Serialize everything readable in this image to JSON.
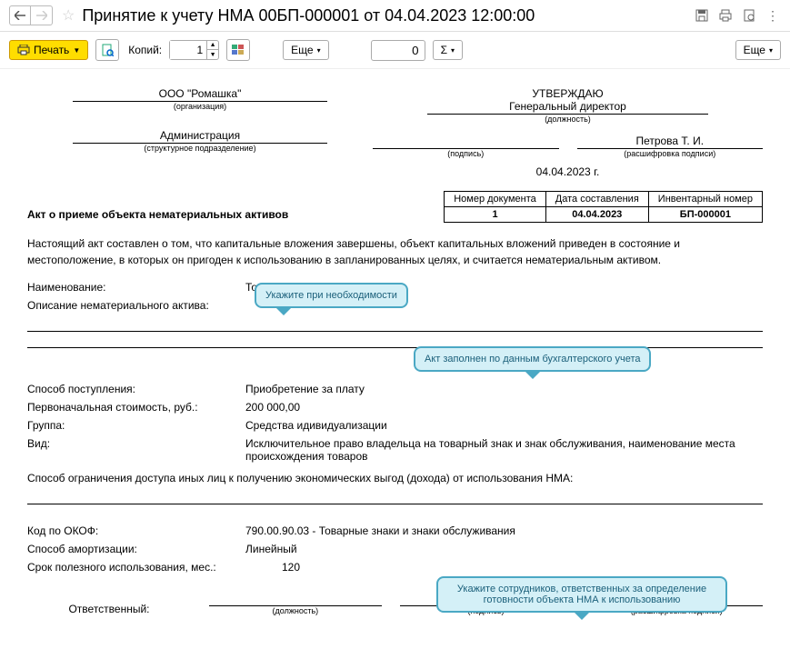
{
  "titlebar": {
    "title": "Принятие к учету НМА 00БП-000001 от 04.04.2023 12:00:00"
  },
  "toolbar": {
    "print": "Печать",
    "copies_label": "Копий:",
    "copies_value": "1",
    "more1": "Еще",
    "num_value": "0",
    "sigma": "Σ",
    "more2": "Еще"
  },
  "header": {
    "org": "ООО \"Ромашка\"",
    "org_cap": "(организация)",
    "dept": "Администрация",
    "dept_cap": "(структурное подразделение)",
    "approve": "УТВЕРЖДАЮ",
    "position": "Генеральный директор",
    "position_cap": "(должность)",
    "sign_cap": "(подпись)",
    "name": "Петрова Т. И.",
    "name_cap": "(расшифровка подписи)",
    "date": "04.04.2023 г."
  },
  "act": {
    "title": "Акт о приеме объекта нематериальных активов",
    "col1": "Номер документа",
    "col2": "Дата составления",
    "col3": "Инвентарный номер",
    "val1": "1",
    "val2": "04.04.2023",
    "val3": "БП-000001"
  },
  "body": {
    "text": "Настоящий акт составлен о том, что капитальные вложения завершены, объект капитальных вложений приведен в состояние и местоположение, в которых он пригоден к использованию в запланированных целях, и считается нематериальным активом.",
    "name_label": "Наименование:",
    "name_value": "Товарный знак",
    "desc_label": "Описание нематериального актива:",
    "method_label": "Способ поступления:",
    "method_value": "Приобретение за плату",
    "cost_label": "Первоначальная стоимость, руб.:",
    "cost_value": "200 000,00",
    "group_label": "Группа:",
    "group_value": "Средства идивидуализации",
    "kind_label": "Вид:",
    "kind_value": "Исключительное право владельца на товарный знак и знак обслуживания, наименование места происхождения товаров",
    "restrict": "Способ ограничения доступа иных лиц к получению экономических выгод (дохода) от использования НМА:",
    "okof_label": "Код по ОКОФ:",
    "okof_value": "790.00.90.03 - Товарные знаки и знаки обслуживания",
    "amort_label": "Способ амортизации:",
    "amort_value": "Линейный",
    "life_label": "Срок полезного использования, мес.:",
    "life_value": "120"
  },
  "callouts": {
    "c1": "Укажите при необходимости",
    "c2": "Акт заполнен по данным бухгалтерского учета",
    "c3": "Укажите сотрудников, ответственных за определение готовности объекта НМА к использованию"
  },
  "responsible": {
    "label": "Ответственный:",
    "position_cap": "(должность)",
    "sign_cap": "(подпись)",
    "name_cap": "(расшифровка подписи)"
  }
}
